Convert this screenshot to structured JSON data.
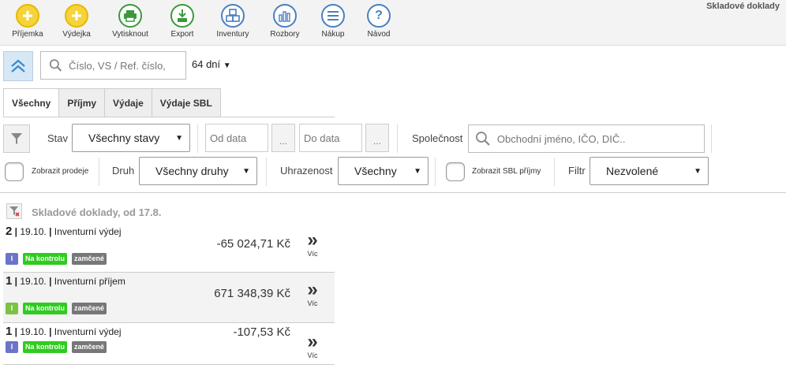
{
  "toolbar": {
    "title": "Skladové doklady",
    "buttons": [
      {
        "label": "Příjemka",
        "icon": "plus-icon",
        "color": "#e8b800"
      },
      {
        "label": "Výdejka",
        "icon": "plus-icon",
        "color": "#e8b800"
      },
      {
        "label": "Vytisknout",
        "icon": "printer-icon",
        "color": "#3a9a3a"
      },
      {
        "label": "Export",
        "icon": "export-icon",
        "color": "#3a9a3a"
      },
      {
        "label": "Inventury",
        "icon": "inventory-icon",
        "color": "#4a7fc1"
      },
      {
        "label": "Rozbory",
        "icon": "chart-icon",
        "color": "#4a7fc1"
      },
      {
        "label": "Nákup",
        "icon": "menu-icon",
        "color": "#4a7fc1"
      },
      {
        "label": "Návod",
        "icon": "help-icon",
        "color": "#4a7fc1"
      }
    ]
  },
  "search": {
    "placeholder": "Číslo, VS / Ref. číslo,",
    "days": "64 dní"
  },
  "tabs": [
    "Všechny",
    "Příjmy",
    "Výdaje",
    "Výdaje SBL"
  ],
  "filters": {
    "state_label": "Stav",
    "state_value": "Všechny stavy",
    "date_from": "Od data",
    "date_to": "Do data",
    "dots": "...",
    "company_label": "Společnost",
    "company_placeholder": "Obchodní jméno, IČO, DIČ..",
    "show_sales": "Zobrazit prodeje",
    "kind_label": "Druh",
    "kind_value": "Všechny druhy",
    "paid_label": "Uhrazenost",
    "paid_value": "Všechny",
    "show_sbl": "Zobrazit SBL příjmy",
    "filter_label": "Filtr",
    "filter_value": "Nezvolené"
  },
  "list": {
    "title": "Skladové doklady, od 17.8.",
    "items": [
      {
        "num": "2",
        "date": "19.10.",
        "name": "Inventurní výdej",
        "amount": "-65 024,71 Kč",
        "type": "I",
        "type_color": "#6b74c9",
        "status": "Na kontrolu",
        "lock": "zamčené",
        "more": "Víc"
      },
      {
        "num": "1",
        "date": "19.10.",
        "name": "Inventurní příjem",
        "amount": "671 348,39 Kč",
        "type": "I",
        "type_color": "#7cc243",
        "status": "Na kontrolu",
        "lock": "zamčené",
        "more": "Víc"
      },
      {
        "num": "1",
        "date": "19.10.",
        "name": "Inventurní výdej",
        "amount": "-107,53 Kč",
        "type": "I",
        "type_color": "#6b74c9",
        "status": "Na kontrolu",
        "lock": "zamčené",
        "more": "Víc"
      }
    ]
  }
}
